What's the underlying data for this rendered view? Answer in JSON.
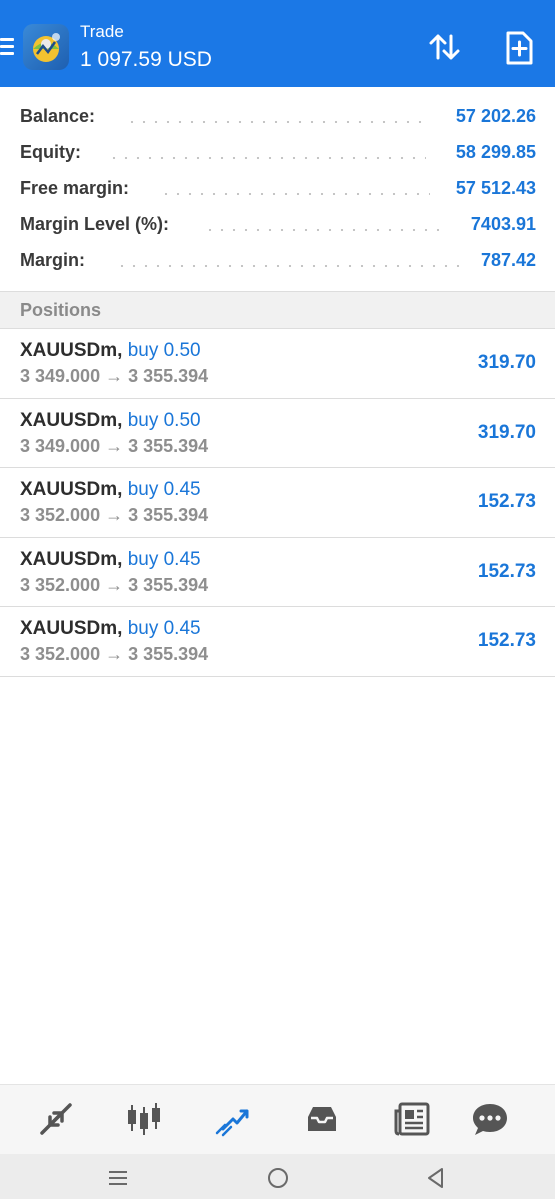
{
  "header": {
    "title": "Trade",
    "subtitle": "1 097.59 USD",
    "menu_icon": "hamburger-icon",
    "logo_icon": "metatrader-logo",
    "sort_icon": "sort-arrows-icon",
    "new_order_icon": "new-document-icon",
    "background_color": "#1b78e6"
  },
  "summary": {
    "rows": [
      {
        "label": "Balance:",
        "value": "57 202.26"
      },
      {
        "label": "Equity:",
        "value": "58 299.85"
      },
      {
        "label": "Free margin:",
        "value": "57 512.43"
      },
      {
        "label": "Margin Level (%):",
        "value": "7403.91"
      },
      {
        "label": "Margin:",
        "value": "787.42"
      }
    ]
  },
  "positions": {
    "title": "Positions",
    "items": [
      {
        "symbol": "XAUUSDm,",
        "side": "buy 0.50",
        "prices": "3 349.000 → 3 355.394",
        "profit": "319.70"
      },
      {
        "symbol": "XAUUSDm,",
        "side": "buy 0.50",
        "prices": "3 349.000 → 3 355.394",
        "profit": "319.70"
      },
      {
        "symbol": "XAUUSDm,",
        "side": "buy 0.45",
        "prices": "3 352.000 → 3 355.394",
        "profit": "152.73"
      },
      {
        "symbol": "XAUUSDm,",
        "side": "buy 0.45",
        "prices": "3 352.000 → 3 355.394",
        "profit": "152.73"
      },
      {
        "symbol": "XAUUSDm,",
        "side": "buy 0.45",
        "prices": "3 352.000 → 3 355.394",
        "profit": "152.73"
      }
    ]
  },
  "bottom_nav": {
    "items": [
      {
        "icon": "quotes-icon",
        "active": false
      },
      {
        "icon": "chart-icon",
        "active": false
      },
      {
        "icon": "trade-icon",
        "active": true
      },
      {
        "icon": "history-icon",
        "active": false
      },
      {
        "icon": "news-icon",
        "active": false
      },
      {
        "icon": "messages-icon",
        "active": false
      }
    ],
    "active_color": "#1a76d8",
    "inactive_color": "#555555"
  },
  "system_nav": {
    "items": [
      "recents-icon",
      "home-icon",
      "back-icon"
    ]
  }
}
